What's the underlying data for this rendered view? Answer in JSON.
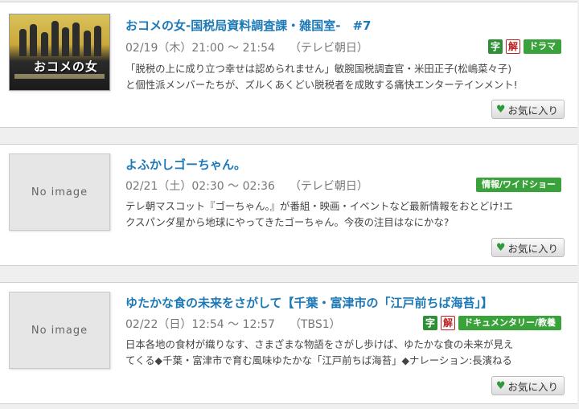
{
  "programs": [
    {
      "thumb": {
        "type": "poster",
        "label": "おコメの女"
      },
      "title": "おコメの女-国税局資料調査課・雑国室-　#7",
      "datetime": "02/19（木）21:00 ～ 21:54",
      "channel": "（テレビ朝日）",
      "desc_lines": [
        "「脱税の上に成り立つ幸せは認められません」敏腕国税調査官・米田正子(松嶋菜々子)",
        "と個性派メンバーたちが、ズルくあくどい脱税者を成敗する痛快エンターテインメント!"
      ],
      "badges": {
        "ji": "字",
        "kai": "解"
      },
      "genre": "ドラマ",
      "favorite": "お気に入り"
    },
    {
      "thumb": {
        "type": "placeholder",
        "label": "No image"
      },
      "title": "よふかしゴーちゃん。",
      "datetime": "02/21（土）02:30 ～ 02:36",
      "channel": "（テレビ朝日）",
      "desc_lines": [
        "テレ朝マスコット『ゴーちゃん。』が番組・映画・イベントなど最新情報をおとどけ!エ",
        "クスパンダ星から地球にやってきたゴーちゃん。今夜の注目はなにかな?"
      ],
      "genre": "情報/ワイドショー",
      "favorite": "お気に入り"
    },
    {
      "thumb": {
        "type": "placeholder",
        "label": "No image"
      },
      "title": "ゆたかな食の未来をさがして【千葉・富津市の「江戸前ちば海苔」】",
      "datetime": "02/22（日）12:54 ～ 12:57",
      "channel": "（TBS1）",
      "desc_lines": [
        "日本各地の食材が織りなす、さまざまな物語をさがし歩けば、ゆたかな食の未来が見え",
        "てくる◆千葉・富津市で育む風味ゆたかな「江戸前ちば海苔」◆ナレーション:長濱ねる"
      ],
      "badges": {
        "ji": "字",
        "kai": "解"
      },
      "genre": "ドキュメンタリー/教養",
      "favorite": "お気に入り"
    }
  ],
  "colors": {
    "title": "#1c79b7",
    "genre": "#3aa23a",
    "heart": "#2f9a3c",
    "kai": "#c02222"
  },
  "icons": {
    "favorite": "heart-icon"
  }
}
